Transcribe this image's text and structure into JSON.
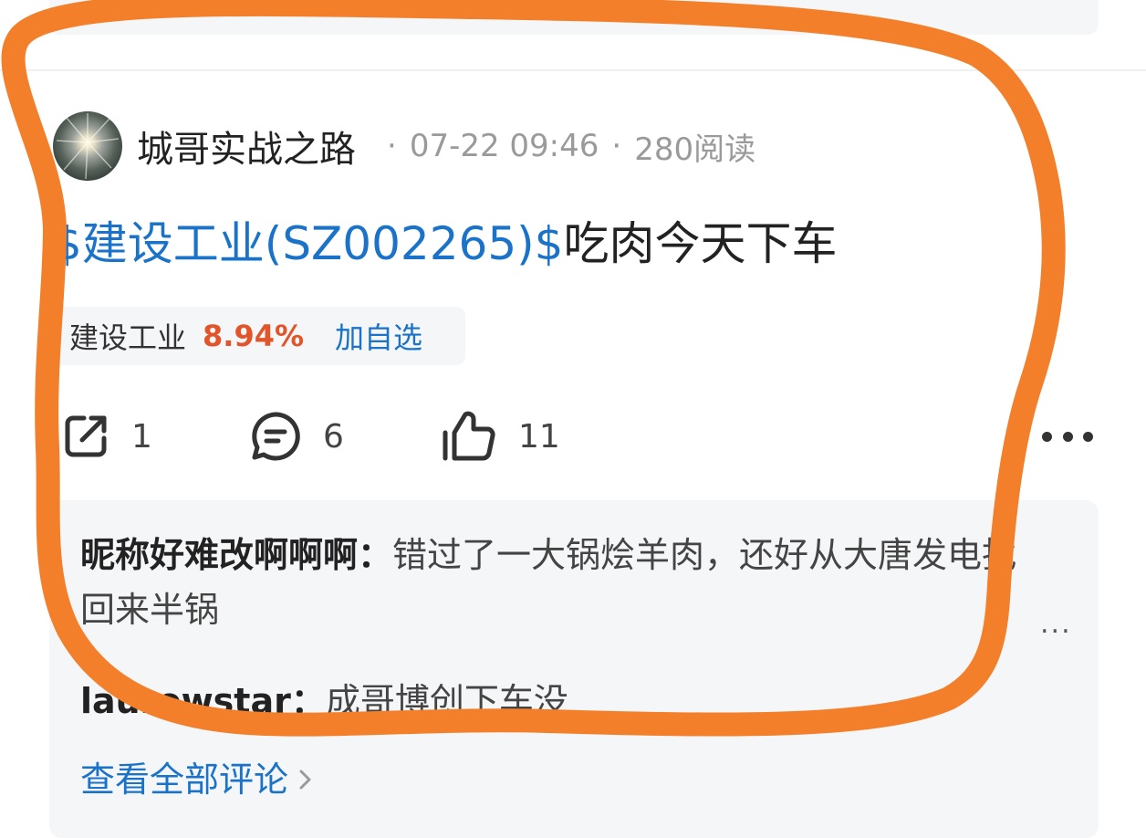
{
  "post": {
    "author": "城哥实战之路",
    "date": "07-22 09:46",
    "reads": "280阅读",
    "separator": "·",
    "title_stock": "$建设工业(SZ002265)$",
    "title_text": "吃肉今天下车"
  },
  "stock_chip": {
    "name": "建设工业",
    "change": "8.94%",
    "add_label": "加自选",
    "change_color": "#e2552a"
  },
  "actions": {
    "share_icon": "share-icon",
    "share_count": "1",
    "comment_icon": "comment-icon",
    "comment_count": "6",
    "like_icon": "thumbs-up-icon",
    "like_count": "11",
    "more_icon": "more-icon"
  },
  "comments": [
    {
      "user": "昵称好难改啊啊啊：",
      "text": "错过了一大锅烩羊肉，还好从大唐发电找回来半锅"
    },
    {
      "user": "laurowstar：",
      "text": "成哥博创下车没"
    }
  ],
  "comment_more": "...",
  "view_all": "查看全部评论",
  "colors": {
    "link": "#1a73c8",
    "annotation": "#f47f2b"
  }
}
